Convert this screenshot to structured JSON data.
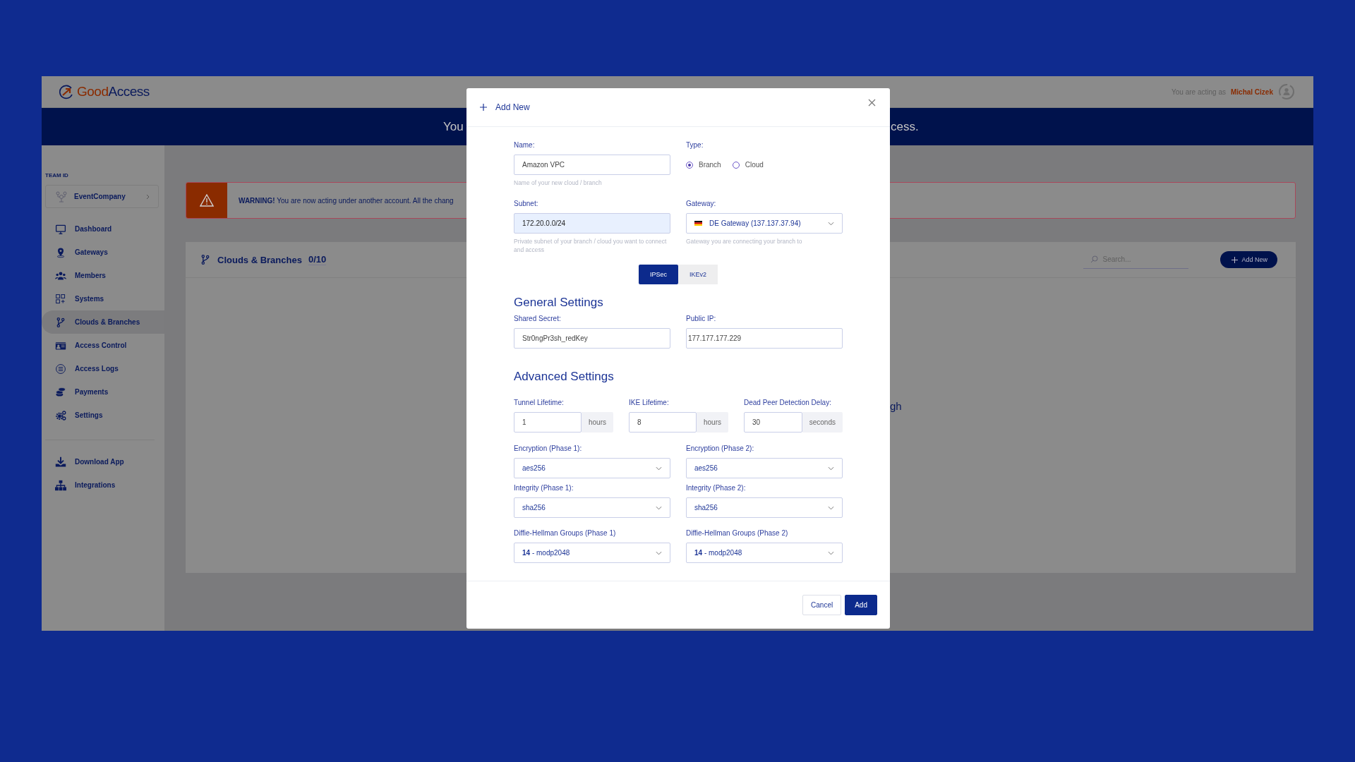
{
  "header": {
    "logo_first": "Good",
    "logo_second": "Access",
    "acting_label": "You are acting as",
    "acting_user": "Michal Cizek"
  },
  "banner": {
    "fragment_left": "You",
    "fragment_right": "cess."
  },
  "sidebar": {
    "team_label": "TEAM ID",
    "team": "EventCompany",
    "items": [
      {
        "label": "Dashboard",
        "selected": false
      },
      {
        "label": "Gateways",
        "selected": false
      },
      {
        "label": "Members",
        "selected": false
      },
      {
        "label": "Systems",
        "selected": false
      },
      {
        "label": "Clouds & Branches",
        "selected": true
      },
      {
        "label": "Access Control",
        "selected": false
      },
      {
        "label": "Access Logs",
        "selected": false
      },
      {
        "label": "Payments",
        "selected": false
      },
      {
        "label": "Settings",
        "selected": false
      }
    ],
    "bottom_items": [
      {
        "label": "Download App",
        "selected": false
      },
      {
        "label": "Integrations",
        "selected": false
      }
    ]
  },
  "warning": {
    "text": "**WARNING!** You are now acting under another account. All the chang"
  },
  "card": {
    "title": "Clouds & Branches",
    "count": "0/10",
    "search_placeholder": "Search...",
    "add_button": "Add New",
    "fragment": "gh"
  },
  "modal": {
    "title": "Add New",
    "name": {
      "label": "Name:",
      "value": "Amazon VPC",
      "hint": "Name of your new cloud / branch"
    },
    "type": {
      "label": "Type:",
      "options": [
        {
          "label": "Branch",
          "selected": true
        },
        {
          "label": "Cloud",
          "selected": false
        }
      ]
    },
    "subnet": {
      "label": "Subnet:",
      "value": "172.20.0.0/24",
      "hint": "Private subnet of your branch / cloud you want to connect and access",
      "autofilled": true
    },
    "gateway": {
      "label": "Gateway:",
      "value": "DE Gateway (137.137.37.94)",
      "hint": "Gateway you are connecting your branch to"
    },
    "protocol_tabs": [
      {
        "label": "IPSec",
        "selected": true
      },
      {
        "label": "IKEv2",
        "selected": false
      }
    ],
    "general": {
      "heading": "General Settings",
      "fields": [
        {
          "label": "Shared Secret:",
          "value": "Str0ngPr3sh_redKey"
        },
        {
          "label": "Public IP:",
          "value": "177.177.177.229"
        }
      ]
    },
    "advanced": {
      "heading": "Advanced Settings",
      "lifetimes": [
        {
          "label": "Tunnel Lifetime:",
          "value": "1",
          "unit": "hours"
        },
        {
          "label": "IKE Lifetime:",
          "value": "8",
          "unit": "hours"
        },
        {
          "label": "Dead Peer Detection Delay:",
          "value": "30",
          "unit": "seconds"
        }
      ],
      "selects": [
        {
          "label": "Encryption (Phase 1):",
          "value": "aes256"
        },
        {
          "label": "Encryption (Phase 2):",
          "value": "aes256"
        },
        {
          "label": "Integrity (Phase 1):",
          "value": "sha256"
        },
        {
          "label": "Integrity (Phase 2):",
          "value": "sha256"
        },
        {
          "label": "Diffie-Hellman Groups (Phase 1)",
          "value": "**14** - modp2048"
        },
        {
          "label": "Diffie-Hellman Groups (Phase 2)",
          "value": "**14** - modp2048"
        }
      ]
    },
    "cancel_button": "Cancel",
    "add_button": "Add"
  }
}
